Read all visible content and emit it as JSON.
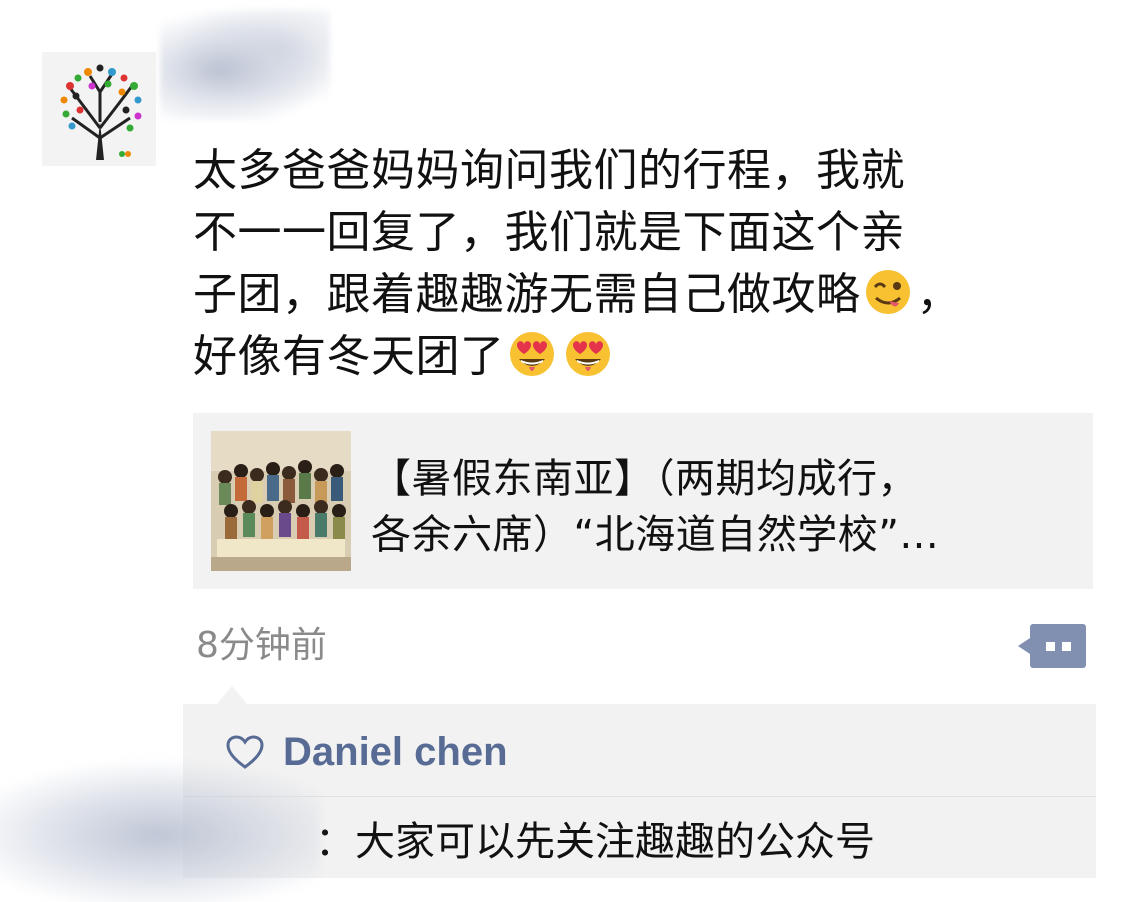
{
  "post": {
    "text_line1": "太多爸爸妈妈询问我们的行程，我就",
    "text_line2": "不一一回复了，我们就是下面这个亲",
    "text_line3a": "子团，跟着趣趣游无需自己做攻略",
    "text_line3b": "，",
    "text_line4": "好像有冬天团了",
    "emoji_wink": "winking-face-with-tongue-emoji",
    "emoji_love": "heart-eyes-emoji",
    "time": "8分钟前"
  },
  "link_card": {
    "title_line1": "【暑假东南亚】（两期均成行，",
    "title_line2": "各余六席）“北海道自然学校”..."
  },
  "comments": {
    "likes": [
      "Daniel chen"
    ],
    "items": [
      {
        "text": "：大家可以先关注趣趣的公众号"
      }
    ]
  },
  "colors": {
    "link_blue": "#576b95",
    "panel_bg": "#f2f2f2",
    "time_gray": "#8a8a8a",
    "text": "#111111"
  },
  "icons": {
    "like": "heart-outline-icon",
    "comment": "comment-dots-icon",
    "avatar": "tree-avatar"
  }
}
